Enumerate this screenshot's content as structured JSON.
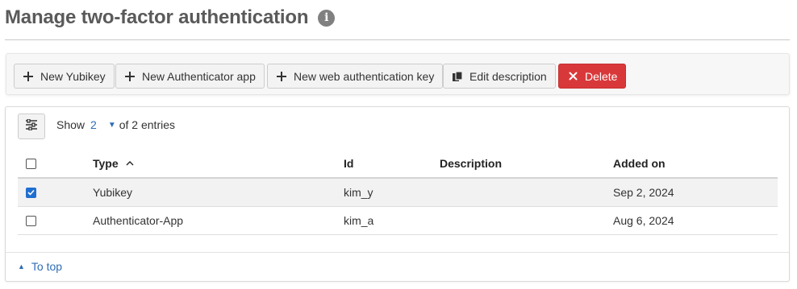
{
  "page": {
    "title": "Manage two-factor authentication",
    "info_icon": "info-icon"
  },
  "toolbar": {
    "buttons": [
      {
        "label": "New Yubikey",
        "icon": "plus-icon"
      },
      {
        "label": "New Authenticator app",
        "icon": "plus-icon"
      },
      {
        "label": "New web authentication key",
        "icon": "plus-icon"
      },
      {
        "label": "Edit description",
        "icon": "copy-icon"
      },
      {
        "label": "Delete",
        "icon": "x-icon"
      }
    ],
    "delete_color": "#d9383a"
  },
  "table": {
    "show_label": "Show",
    "page_size": "2",
    "entries_text": "of 2 entries",
    "columns": [
      "Type",
      "Id",
      "Description",
      "Added on"
    ],
    "sort": {
      "column": "Type",
      "direction": "ascending"
    },
    "rows": [
      {
        "checked": true,
        "type": "Yubikey",
        "id": "kim_y",
        "description": "",
        "added_on": "Sep 2, 2024"
      },
      {
        "checked": false,
        "type": "Authenticator-App",
        "id": "kim_a",
        "description": "",
        "added_on": "Aug 6, 2024"
      }
    ]
  },
  "footer": {
    "to_top": "To top"
  },
  "colors": {
    "accent": "#2f6db5",
    "checkbox": "#1f6fd1",
    "selected_row": "#f2f2f2"
  }
}
